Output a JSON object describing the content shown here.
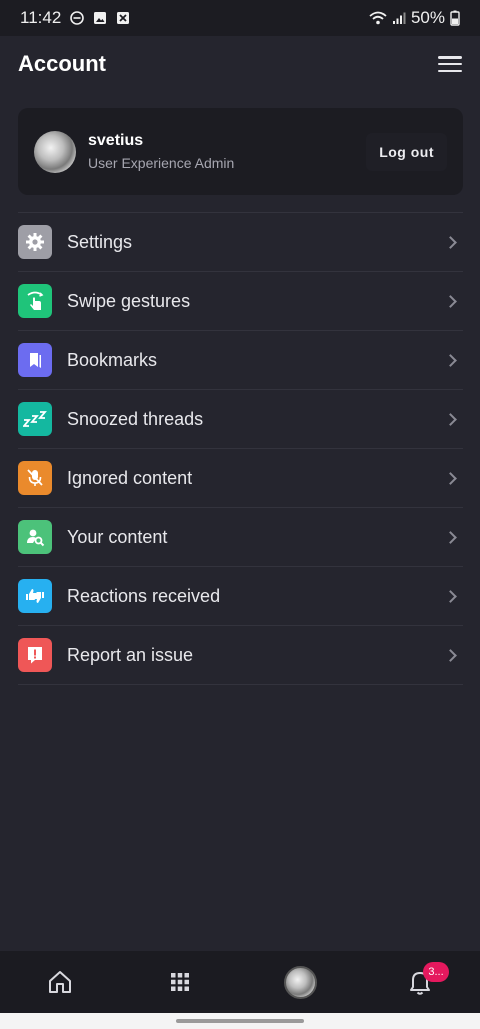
{
  "status_bar": {
    "time": "11:42",
    "battery": "50%"
  },
  "header": {
    "title": "Account"
  },
  "profile": {
    "username": "svetius",
    "role": "User Experience Admin",
    "logout_label": "Log out"
  },
  "menu": {
    "items": [
      {
        "label": "Settings",
        "icon": "gear-icon",
        "color": "#9e9ea6"
      },
      {
        "label": "Swipe gestures",
        "icon": "swipe-hand-icon",
        "color": "#1fc47a"
      },
      {
        "label": "Bookmarks",
        "icon": "bookmark-icon",
        "color": "#6c6cf0"
      },
      {
        "label": "Snoozed threads",
        "icon": "snooze-icon",
        "color": "#14b8a0"
      },
      {
        "label": "Ignored content",
        "icon": "mic-off-icon",
        "color": "#ea8a2c"
      },
      {
        "label": "Your content",
        "icon": "user-search-icon",
        "color": "#4cc27a"
      },
      {
        "label": "Reactions received",
        "icon": "thumbs-icon",
        "color": "#27b0f0"
      },
      {
        "label": "Report an issue",
        "icon": "report-icon",
        "color": "#ef5757"
      }
    ]
  },
  "bottom_nav": {
    "notifications_badge": "3..."
  }
}
